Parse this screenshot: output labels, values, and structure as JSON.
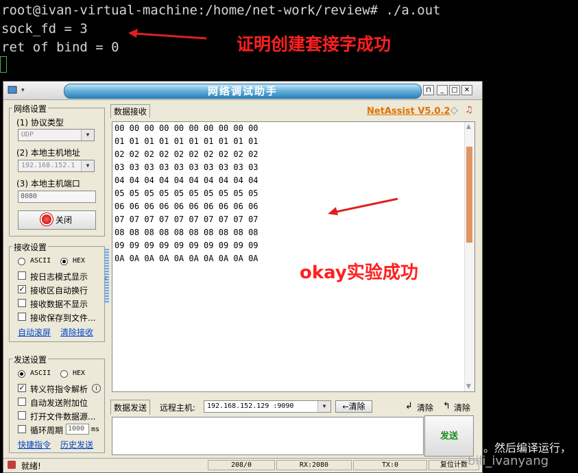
{
  "terminal": {
    "lines": [
      "root@ivan-virtual-machine:/home/net-work/review# ./a.out",
      "sock_fd = 3",
      "ret of bind = 0"
    ]
  },
  "annotations": {
    "bind_success": "证明创建套接字成功",
    "okay_success": "okay实验成功",
    "arrow_color": "#e02020"
  },
  "window": {
    "title": "网络调试助手",
    "sys_menu": "▾",
    "buttons": {
      "pin": "⊓",
      "min": "_",
      "max": "□",
      "close": "✕"
    }
  },
  "net_settings": {
    "group_title": "网络设置",
    "protocol_label": "(1) 协议类型",
    "protocol_value": "UDP",
    "host_label": "(2) 本地主机地址",
    "host_value": "192.168.152.1",
    "port_label": "(3) 本地主机端口",
    "port_value": "8080",
    "close_button": "关闭"
  },
  "recv_settings": {
    "group_title": "接收设置",
    "ascii": "ASCII",
    "hex": "HEX",
    "options": [
      "按日志模式显示",
      "接收区自动换行",
      "接收数据不显示",
      "接收保存到文件..."
    ],
    "checked": [
      false,
      true,
      false,
      false
    ],
    "link_auto_scroll": "自动滚屏",
    "link_clear_recv": "清除接收"
  },
  "send_settings": {
    "group_title": "发送设置",
    "ascii": "ASCII",
    "hex": "HEX",
    "options": [
      "转义符指令解析",
      "自动发送附加位",
      "打开文件数据源...",
      "循环周期"
    ],
    "checked": [
      true,
      false,
      false,
      false
    ],
    "cycle_value": "1000",
    "cycle_unit": "ms",
    "link_shortcut": "快捷指令",
    "link_history": "历史发送"
  },
  "recv_panel": {
    "tab": "数据接收",
    "brand": "NetAssist V5.0.2",
    "rows": [
      "00 00 00 00 00 00 00 00 00 00",
      "01 01 01 01 01 01 01 01 01 01",
      "02 02 02 02 02 02 02 02 02 02",
      "03 03 03 03 03 03 03 03 03 03",
      "04 04 04 04 04 04 04 04 04 04",
      "05 05 05 05 05 05 05 05 05 05",
      "06 06 06 06 06 06 06 06 06 06",
      "07 07 07 07 07 07 07 07 07 07",
      "08 08 08 08 08 08 08 08 08 08",
      "09 09 09 09 09 09 09 09 09 09",
      "0A 0A 0A 0A 0A 0A 0A 0A 0A 0A"
    ]
  },
  "send_panel": {
    "tab": "数据发送",
    "remote_label": "远程主机:",
    "remote_value": "192.168.152.129 :9090",
    "clear_button": "清除",
    "clear1": "清除",
    "clear2": "清除",
    "send_button": "发送"
  },
  "status_bar": {
    "ready": "就绪!",
    "count": "208/0",
    "rx": "RX:2080",
    "tx": "TX:0",
    "reset": "复位计数"
  },
  "watermark": {
    "partial_text": "。然后编译运行，",
    "credit": "bili_ivanyang"
  }
}
